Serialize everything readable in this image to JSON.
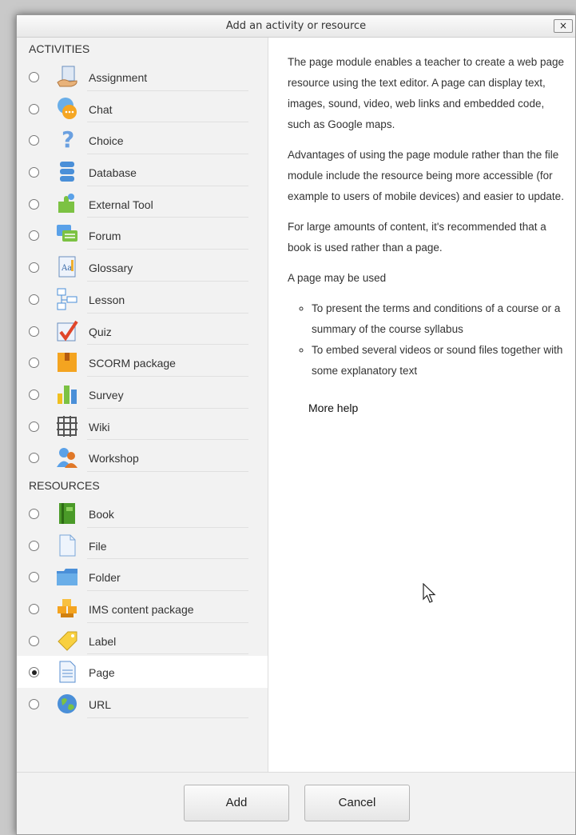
{
  "dialog": {
    "title": "Add an activity or resource",
    "close_label": "×"
  },
  "activities": {
    "heading": "ACTIVITIES",
    "items": [
      {
        "label": "Assignment",
        "icon": "assignment-icon"
      },
      {
        "label": "Chat",
        "icon": "chat-icon"
      },
      {
        "label": "Choice",
        "icon": "choice-icon"
      },
      {
        "label": "Database",
        "icon": "database-icon"
      },
      {
        "label": "External Tool",
        "icon": "external-tool-icon"
      },
      {
        "label": "Forum",
        "icon": "forum-icon"
      },
      {
        "label": "Glossary",
        "icon": "glossary-icon"
      },
      {
        "label": "Lesson",
        "icon": "lesson-icon"
      },
      {
        "label": "Quiz",
        "icon": "quiz-icon"
      },
      {
        "label": "SCORM package",
        "icon": "scorm-icon"
      },
      {
        "label": "Survey",
        "icon": "survey-icon"
      },
      {
        "label": "Wiki",
        "icon": "wiki-icon"
      },
      {
        "label": "Workshop",
        "icon": "workshop-icon"
      }
    ]
  },
  "resources": {
    "heading": "RESOURCES",
    "items": [
      {
        "label": "Book",
        "icon": "book-icon"
      },
      {
        "label": "File",
        "icon": "file-icon"
      },
      {
        "label": "Folder",
        "icon": "folder-icon"
      },
      {
        "label": "IMS content package",
        "icon": "ims-package-icon"
      },
      {
        "label": "Label",
        "icon": "label-icon"
      },
      {
        "label": "Page",
        "icon": "page-icon",
        "selected": true
      },
      {
        "label": "URL",
        "icon": "url-icon"
      }
    ]
  },
  "help": {
    "paragraph_1": "The page module enables a teacher to create a web page resource using the text editor. A page can display text, images, sound, video, web links and embedded code, such as Google maps.",
    "paragraph_2": "Advantages of using the page module rather than the file module include the resource being more accessible (for example to users of mobile devices) and easier to update.",
    "paragraph_3": "For large amounts of content, it's recommended that a book is used rather than a page.",
    "paragraph_4": "A page may be used",
    "bullets": [
      "To present the terms and conditions of a course or a summary of the course syllabus",
      "To embed several videos or sound files together with some explanatory text"
    ],
    "more_help": "More help"
  },
  "footer": {
    "add_label": "Add",
    "cancel_label": "Cancel"
  },
  "colors": {
    "panel_bg": "#f2f2f2",
    "selected_row_bg": "#ffffff",
    "text": "#333333"
  }
}
